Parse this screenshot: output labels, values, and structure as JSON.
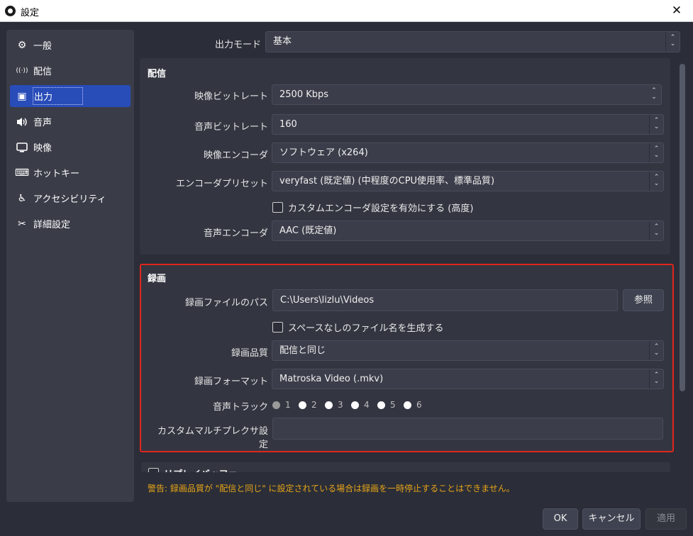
{
  "window": {
    "title": "設定",
    "close_label": "✕"
  },
  "sidebar": {
    "items": [
      {
        "label": "一般",
        "icon": "gear-icon",
        "glyph": "⚙",
        "active": false
      },
      {
        "label": "配信",
        "icon": "broadcast-icon",
        "glyph": "((·))",
        "active": false
      },
      {
        "label": "出力",
        "icon": "output-icon",
        "glyph": "▣",
        "active": true
      },
      {
        "label": "音声",
        "icon": "speaker-icon",
        "glyph": "🔈",
        "active": false
      },
      {
        "label": "映像",
        "icon": "monitor-icon",
        "glyph": "▭",
        "active": false
      },
      {
        "label": "ホットキー",
        "icon": "keyboard-icon",
        "glyph": "⌨",
        "active": false
      },
      {
        "label": "アクセシビリティ",
        "icon": "accessibility-icon",
        "glyph": "♿",
        "active": false
      },
      {
        "label": "詳細設定",
        "icon": "tools-icon",
        "glyph": "✂",
        "active": false
      }
    ]
  },
  "output_mode": {
    "label": "出力モード",
    "value": "基本"
  },
  "streaming": {
    "title": "配信",
    "video_bitrate": {
      "label": "映像ビットレート",
      "value": "2500 Kbps"
    },
    "audio_bitrate": {
      "label": "音声ビットレート",
      "value": "160"
    },
    "video_encoder": {
      "label": "映像エンコーダ",
      "value": "ソフトウェア (x264)"
    },
    "encoder_preset": {
      "label": "エンコーダプリセット",
      "value": "veryfast (既定値) (中程度のCPU使用率、標準品質)"
    },
    "custom_encoder_check": {
      "label": "カスタムエンコーダ設定を有効にする (高度)",
      "checked": false
    },
    "audio_encoder": {
      "label": "音声エンコーダ",
      "value": "AAC (既定値)"
    }
  },
  "recording": {
    "title": "録画",
    "path": {
      "label": "録画ファイルのパス",
      "value": "C:\\Users\\lizlu\\Videos",
      "browse_label": "参照"
    },
    "no_space_check": {
      "label": "スペースなしのファイル名を生成する",
      "checked": false
    },
    "quality": {
      "label": "録画品質",
      "value": "配信と同じ"
    },
    "format": {
      "label": "録画フォーマット",
      "value": "Matroska Video (.mkv)"
    },
    "audio_track": {
      "label": "音声トラック",
      "tracks": [
        "1",
        "2",
        "3",
        "4",
        "5",
        "6"
      ],
      "selected": "1"
    },
    "muxer": {
      "label": "カスタムマルチプレクサ設定",
      "value": ""
    }
  },
  "replay_buffer": {
    "label": "リプレイバッファ"
  },
  "warning": "警告: 録画品質が \"配信と同じ\" に設定されている場合は録画を一時停止することはできません。",
  "footer": {
    "ok_label": "OK",
    "cancel_label": "キャンセル",
    "apply_label": "適用"
  },
  "colors": {
    "accent": "#284cb8",
    "warning": "#e6a317",
    "highlight": "#e0261c",
    "background": "#2b2e38"
  }
}
